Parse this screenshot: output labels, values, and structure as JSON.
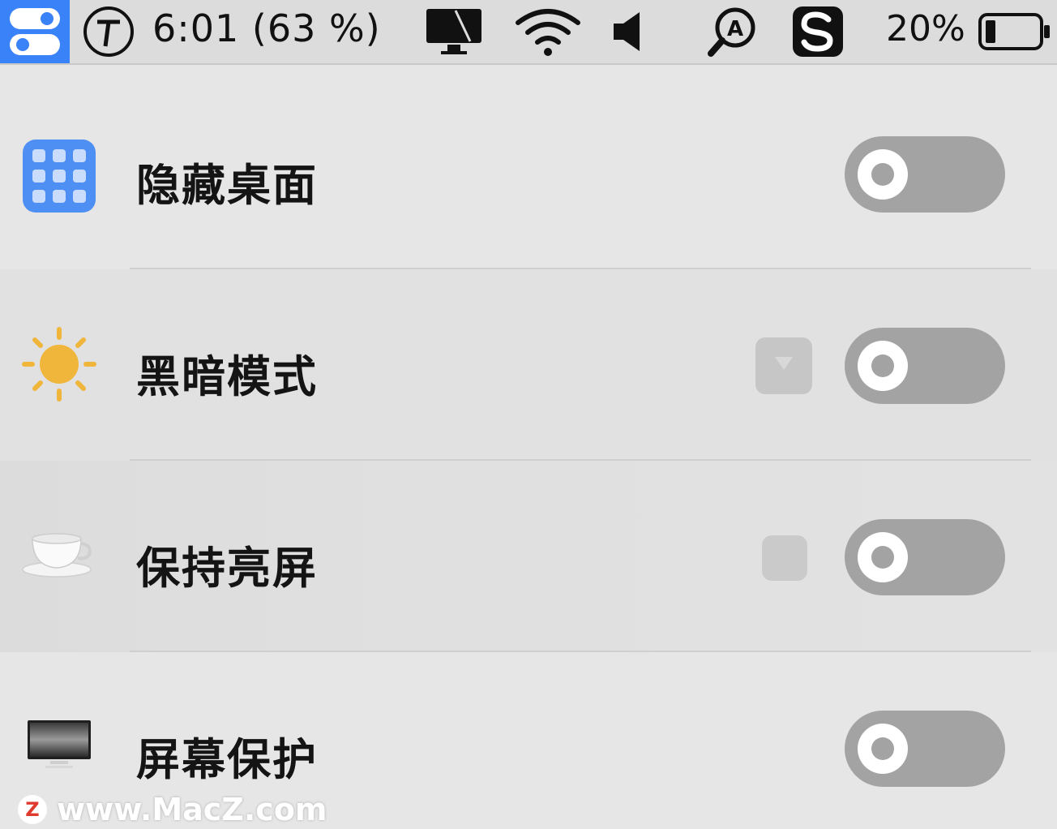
{
  "menubar": {
    "time_display": "6:01 (63 %)",
    "battery_percent": "20%",
    "icons": [
      "toggles-app-icon",
      "timer-t-icon",
      "display-icon",
      "wifi-icon",
      "speaker-icon",
      "spotlight-a-icon",
      "s-app-icon",
      "battery-icon"
    ],
    "battery_level": 0.2
  },
  "rows": [
    {
      "label": "隐藏桌面",
      "icon": "desktop-grid-icon",
      "enabled": false
    },
    {
      "label": "黑暗模式",
      "icon": "sun-icon",
      "enabled": false
    },
    {
      "label": "保持亮屏",
      "icon": "coffee-cup-icon",
      "enabled": false
    },
    {
      "label": "屏幕保护",
      "icon": "monitor-icon",
      "enabled": false
    }
  ],
  "watermark": {
    "logo_letter": "Z",
    "text": "www.MacZ.com"
  },
  "colors": {
    "accent": "#3a82f7",
    "toggle_off": "#a3a3a3",
    "sun": "#f0b63c",
    "watermark_logo": "#e03a2e"
  }
}
